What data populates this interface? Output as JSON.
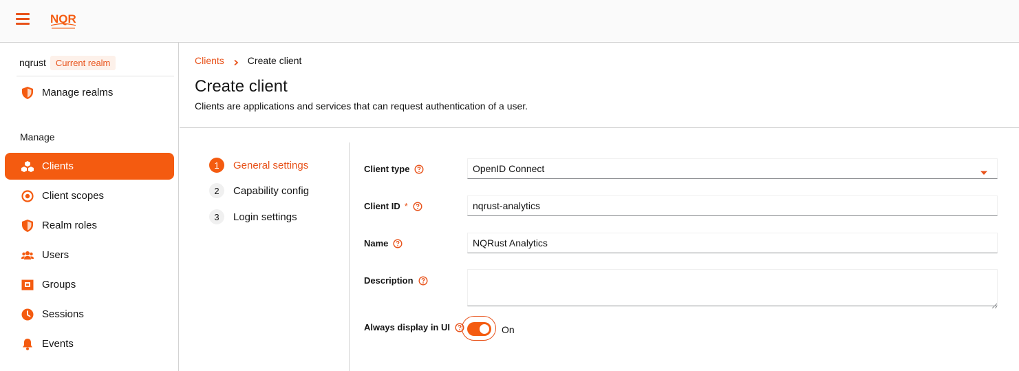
{
  "colors": {
    "accent": "#f45b10",
    "accent_text": "#e8521a",
    "badge_bg": "#fdf1ea"
  },
  "header": {
    "logo_text": "NQR",
    "menu_icon": "hamburger-icon"
  },
  "sidebar": {
    "realm_name": "nqrust",
    "realm_badge": "Current realm",
    "manage_realms": {
      "label": "Manage realms",
      "icon": "shield-icon"
    },
    "section_label": "Manage",
    "items": [
      {
        "label": "Clients",
        "icon": "cubes-icon",
        "active": true
      },
      {
        "label": "Client scopes",
        "icon": "target-icon"
      },
      {
        "label": "Realm roles",
        "icon": "shield-icon"
      },
      {
        "label": "Users",
        "icon": "users-icon"
      },
      {
        "label": "Groups",
        "icon": "groups-icon"
      },
      {
        "label": "Sessions",
        "icon": "clock-icon"
      },
      {
        "label": "Events",
        "icon": "bell-icon"
      }
    ]
  },
  "breadcrumb": {
    "parent": "Clients",
    "current": "Create client"
  },
  "page": {
    "title": "Create client",
    "description": "Clients are applications and services that can request authentication of a user."
  },
  "wizard": {
    "steps": [
      {
        "number": "1",
        "label": "General settings",
        "current": true
      },
      {
        "number": "2",
        "label": "Capability config"
      },
      {
        "number": "3",
        "label": "Login settings"
      }
    ]
  },
  "form": {
    "client_type": {
      "label": "Client type",
      "value": "OpenID Connect"
    },
    "client_id": {
      "label": "Client ID",
      "required_mark": "*",
      "value": "nqrust-analytics"
    },
    "name": {
      "label": "Name",
      "value": "NQRust Analytics"
    },
    "description": {
      "label": "Description",
      "value": ""
    },
    "always_display": {
      "label": "Always display in UI",
      "state_label": "On",
      "checked": true
    }
  }
}
